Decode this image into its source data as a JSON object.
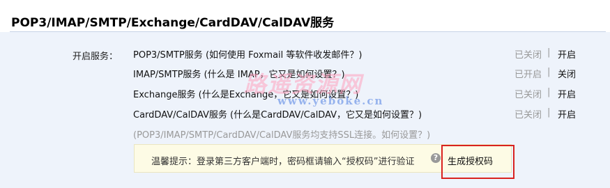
{
  "header": {
    "title": "POP3/IMAP/SMTP/Exchange/CardDAV/CalDAV服务"
  },
  "main": {
    "enable_label": "开启服务：",
    "services": [
      {
        "desc": "POP3/SMTP服务 (如何使用 Foxmail 等软件收发邮件？)",
        "status": "已关闭",
        "separator": "|",
        "action": "开启"
      },
      {
        "desc": "IMAP/SMTP服务 (什么是 IMAP，它又是如何设置？)",
        "status": "已开启",
        "separator": "|",
        "action": "关闭"
      },
      {
        "desc": "Exchange服务 (什么是Exchange，它又是如何设置？)",
        "status": "已关闭",
        "separator": "|",
        "action": "开启"
      },
      {
        "desc": "CardDAV/CalDAV服务 (什么是CardDAV/CalDAV，它又是如何设置？)",
        "status": "已关闭",
        "separator": "|",
        "action": "开启"
      }
    ],
    "ssl_note": "(POP3/IMAP/SMTP/CardDAV/CalDAV服务均支持SSL连接。如何设置？)",
    "tip": {
      "text": "温馨提示：登录第三方客户端时，密码框请输入“授权码”进行验证",
      "help_icon": "?",
      "link": "生成授权码"
    }
  },
  "watermark": {
    "line1": "路遥资源网",
    "line2": "www.yeboke.cn"
  },
  "colors": {
    "highlight_border": "#d9221f",
    "content_bg": "#eef3fb",
    "tip_bg": "#fdfbe5"
  }
}
